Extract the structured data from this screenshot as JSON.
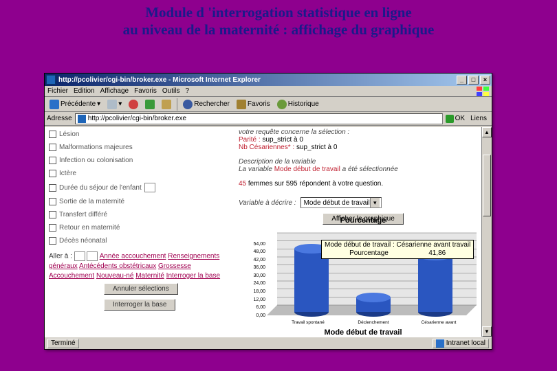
{
  "slide_title_line1": "Module d 'interrogation statistique en ligne",
  "slide_title_line2": "au niveau de la maternité : affichage du graphique",
  "window": {
    "title": "http://pcolivier/cgi-bin/broker.exe - Microsoft Internet Explorer",
    "menu": [
      "Fichier",
      "Edition",
      "Affichage",
      "Favoris",
      "Outils",
      "?"
    ],
    "toolbar": {
      "back": "Précédente",
      "search": "Rechercher",
      "favorites": "Favoris",
      "history": "Historique"
    },
    "address_label": "Adresse",
    "address_value": "http://pcolivier/cgi-bin/broker.exe",
    "go": "OK",
    "links": "Liens"
  },
  "left": {
    "items": [
      "Lésion",
      "Malformations majeures",
      "Infection ou colonisation",
      "Ictère",
      "Durée du séjour de l'enfant",
      "Sortie de la maternité",
      "Transfert différé",
      "Retour en maternité",
      "Décès néonatal"
    ],
    "goto": "Aller à :",
    "nav_links": [
      "Année accouchement",
      "Renseignements généraux",
      "Antécédents obstétricaux",
      "Grossesse",
      "Accouchement",
      "Nouveau-né",
      "Maternité",
      "Interroger la base"
    ],
    "btn_clear": "Annuler sélections",
    "btn_query": "Interroger la base"
  },
  "right": {
    "req_intro": "votre requête concerne la sélection :",
    "req_l1_label": "Parité :",
    "req_l1_val": "sup_strict à 0",
    "req_l2_label": "Nb Césariennes* :",
    "req_l2_val": "sup_strict à 0",
    "desc_title": "Description de la variable",
    "desc_text1": "La variable",
    "desc_var": "Mode début de travail",
    "desc_text2": "a été sélectionnée",
    "count_text": "45 femmes sur 595 répondent à votre question.",
    "count_red": "45",
    "var_label": "Variable à décrire :",
    "var_value": "Mode début de travail",
    "btn_graph": "Afficher le graphique"
  },
  "chart_data": {
    "type": "bar",
    "title": "Pourcentage",
    "xlabel": "Mode début de travail",
    "ylabel": "",
    "ylim": [
      0,
      54
    ],
    "yticks": [
      0,
      6,
      12,
      18,
      24,
      30,
      36,
      42,
      48,
      54
    ],
    "categories": [
      "Travail spontané",
      "Déclenchement",
      "Césarienne avant travail"
    ],
    "values": [
      47,
      11,
      42
    ],
    "tooltip": {
      "line1": "Mode début de travail : Césarienne avant travail",
      "line2": "Pourcentage",
      "value": "41,86"
    }
  },
  "status": {
    "left": "Terminé",
    "right": "Intranet local"
  }
}
